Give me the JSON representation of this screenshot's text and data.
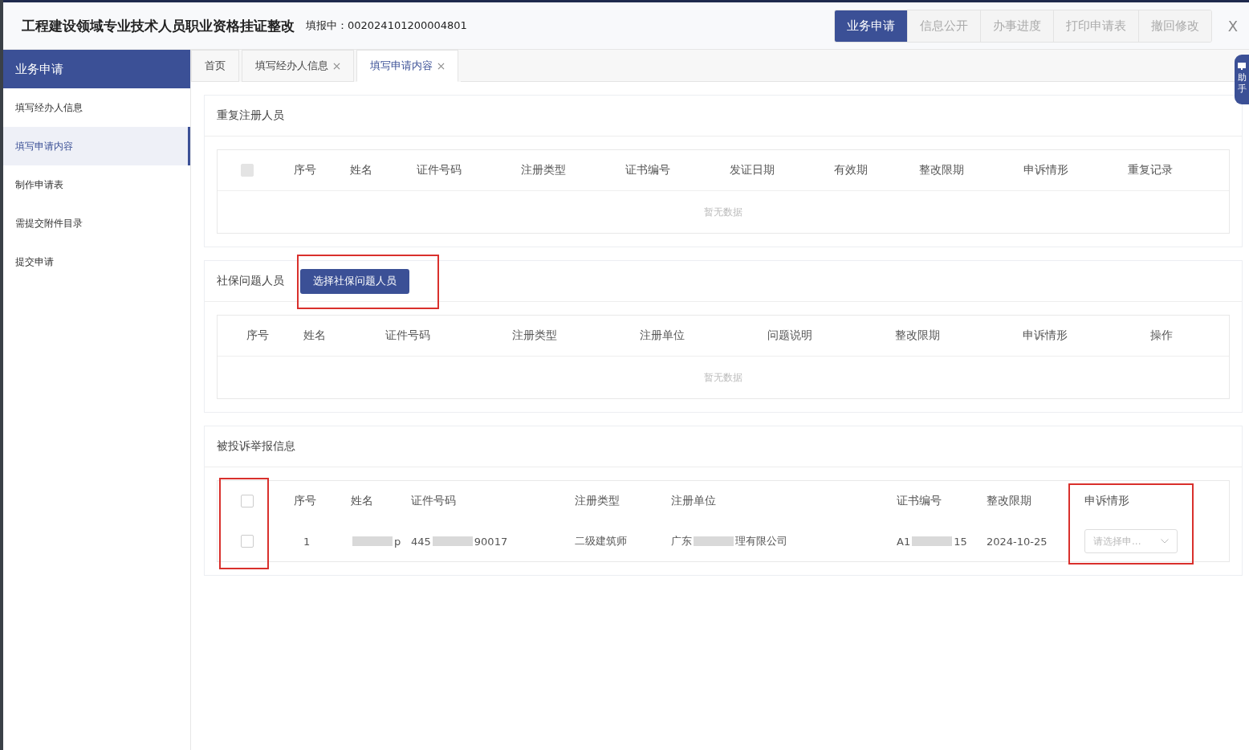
{
  "header": {
    "title": "工程建设领域专业技术人员职业资格挂证整改",
    "status_label": "填报中：",
    "status_number": "002024101200004801",
    "nav": [
      {
        "label": "业务申请",
        "selected": true
      },
      {
        "label": "信息公开",
        "selected": false
      },
      {
        "label": "办事进度",
        "selected": false
      },
      {
        "label": "打印申请表",
        "selected": false
      },
      {
        "label": "撤回修改",
        "selected": false
      }
    ],
    "close": "X"
  },
  "sidebar": {
    "title": "业务申请",
    "items": [
      {
        "label": "填写经办人信息",
        "selected": false
      },
      {
        "label": "填写申请内容",
        "selected": true
      },
      {
        "label": "制作申请表",
        "selected": false
      },
      {
        "label": "需提交附件目录",
        "selected": false
      },
      {
        "label": "提交申请",
        "selected": false
      }
    ]
  },
  "tabs": [
    {
      "label": "首页",
      "closable": false,
      "selected": false
    },
    {
      "label": "填写经办人信息",
      "closable": true,
      "selected": false
    },
    {
      "label": "填写申请内容",
      "closable": true,
      "selected": true
    }
  ],
  "helper": "助手",
  "sections": [
    {
      "title": "重复注册人员",
      "select_all": {
        "checked": false,
        "disabled": true
      },
      "columns": [
        "序号",
        "姓名",
        "证件号码",
        "注册类型",
        "证书编号",
        "发证日期",
        "有效期",
        "整改限期",
        "申诉情形",
        "重复记录"
      ],
      "empty_text": "暂无数据"
    },
    {
      "title": "社保问题人员",
      "button": "选择社保问题人员",
      "columns": [
        "序号",
        "姓名",
        "证件号码",
        "注册类型",
        "注册单位",
        "问题说明",
        "整改限期",
        "申诉情形",
        "操作"
      ],
      "empty_text": "暂无数据"
    },
    {
      "title": "被投诉举报信息",
      "select_all": {
        "checked": false,
        "disabled": false
      },
      "columns": [
        "序号",
        "姓名",
        "证件号码",
        "注册类型",
        "注册单位",
        "证书编号",
        "整改限期",
        "申诉情形"
      ],
      "rows": [
        {
          "checked": false,
          "cells": [
            {
              "kind": "text",
              "text": "1"
            },
            {
              "kind": "redacted",
              "after": "p"
            },
            {
              "kind": "redacted",
              "before": "445",
              "after": "90017"
            },
            {
              "kind": "text",
              "text": "二级建筑师"
            },
            {
              "kind": "redacted",
              "before": "广东",
              "after": "理有限公司"
            },
            {
              "kind": "redacted",
              "before": "A1",
              "after": "15"
            },
            {
              "kind": "text",
              "text": "2024-10-25"
            },
            {
              "kind": "select",
              "placeholder": "请选择申..."
            }
          ]
        }
      ]
    }
  ]
}
